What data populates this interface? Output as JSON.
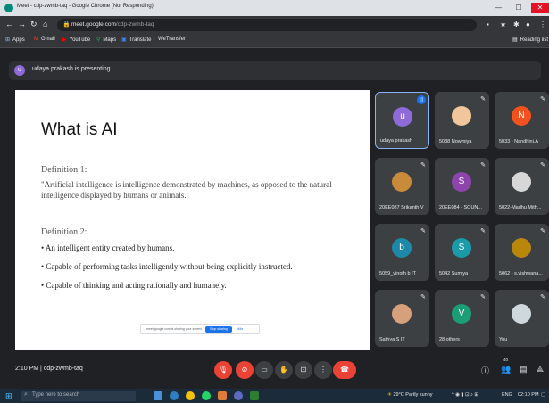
{
  "window": {
    "title": "Meet - cdp-zwmb-taq - Google Chrome (Not Responding)",
    "controls": [
      "—",
      "☐",
      "✕"
    ]
  },
  "browser": {
    "url_host": "meet.google.com",
    "url_path": "/cdp-zwmb-taq",
    "bookmarks": [
      "Apps",
      "Gmail",
      "YouTube",
      "Maps",
      "Translate",
      "WeTransfer"
    ],
    "reading_list": "Reading list"
  },
  "presenting": {
    "avatar_letter": "u",
    "text": "udaya prakash is presenting"
  },
  "slide": {
    "title": "What is AI",
    "def1_heading": "Definition 1:",
    "def1_text": "\"Artificial intelligence is intelligence demonstrated by machines, as opposed to the natural intelligence displayed by humans or animals.",
    "def2_heading": "Definition 2:",
    "bullets": [
      "An intelligent entity created by humans.",
      "Capable of performing tasks intelligently without being explicitly instructed.",
      "Capable of thinking and acting rationally and humanely."
    ],
    "share_text": "meet.google.com is sharing your screen.",
    "stop_sharing": "Stop sharing",
    "hide": "Hide"
  },
  "participants": [
    {
      "name": "udaya prakash",
      "letter": "u",
      "color": "#8e6bd8",
      "kind": "letter",
      "speaking": true
    },
    {
      "name": "5038 Nowmiya",
      "letter": "",
      "color": "#f0c69a",
      "kind": "photo"
    },
    {
      "name": "5033 - Nandhini.A",
      "letter": "N",
      "color": "#f4511e",
      "kind": "letter"
    },
    {
      "name": "20EE087 Srikanth V",
      "letter": "",
      "color": "#c98a3a",
      "kind": "photo"
    },
    {
      "name": "20EE084 - SOUN...",
      "letter": "S",
      "color": "#8e44ad",
      "kind": "letter"
    },
    {
      "name": "5022-Madhu Mith...",
      "letter": "",
      "color": "#d7d7d7",
      "kind": "photo"
    },
    {
      "name": "5059_vinoth b IT",
      "letter": "b",
      "color": "#1e88a8",
      "kind": "letter"
    },
    {
      "name": "5042 Sumiya",
      "letter": "S",
      "color": "#1b9aa8",
      "kind": "letter"
    },
    {
      "name": "5062 - s.vishwana...",
      "letter": "",
      "color": "#b8860b",
      "kind": "photo"
    },
    {
      "name": "Sathya S IT",
      "letter": "",
      "color": "#d6a07a",
      "kind": "photo"
    },
    {
      "name": "28 others",
      "letter": "V",
      "color": "#1b9e77",
      "kind": "letter"
    },
    {
      "name": "You",
      "letter": "",
      "color": "#cfd8dc",
      "kind": "photo"
    }
  ],
  "bottom_bar": {
    "time": "2:10 PM",
    "separator": "|",
    "meeting_code": "cdp-zwmb-taq",
    "participant_count": "40"
  },
  "taskbar": {
    "search_placeholder": "Type here to search",
    "weather": "29°C  Partly sunny",
    "lang": "ENG",
    "clock": "02:10 PM"
  },
  "colors": {
    "accent": "#1a73e8",
    "danger": "#ea4335",
    "background": "#202124",
    "tile": "#3c4043"
  }
}
